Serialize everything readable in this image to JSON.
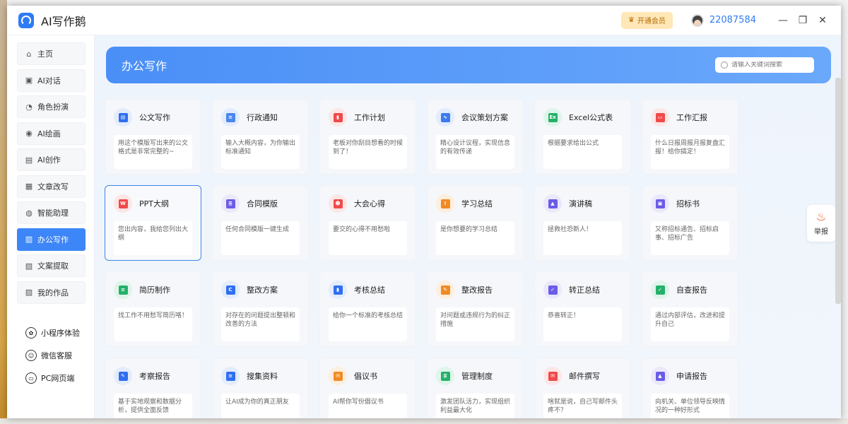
{
  "app": {
    "title": "AI写作鹅",
    "vip_label": "开通会员",
    "username": "22087584"
  },
  "window_controls": {
    "minimize": "—",
    "maximize": "❐",
    "close": "✕"
  },
  "sidebar": {
    "items": [
      {
        "label": "主页",
        "icon": "⌂"
      },
      {
        "label": "AI对话",
        "icon": "▣"
      },
      {
        "label": "角色扮演",
        "icon": "◔"
      },
      {
        "label": "AI绘画",
        "icon": "◉"
      },
      {
        "label": "AI创作",
        "icon": "▤"
      },
      {
        "label": "文章改写",
        "icon": "▦"
      },
      {
        "label": "智能助理",
        "icon": "◍"
      },
      {
        "label": "办公写作",
        "icon": "▥"
      },
      {
        "label": "文案提取",
        "icon": "▧"
      },
      {
        "label": "我的作品",
        "icon": "▨"
      }
    ],
    "active_index": 7,
    "extras": [
      {
        "label": "小程序体验",
        "icon": "✿"
      },
      {
        "label": "微信客服",
        "icon": "☺"
      },
      {
        "label": "PC网页端",
        "icon": "▭"
      }
    ]
  },
  "banner": {
    "title": "办公写作",
    "search_placeholder": "请输入关键词搜索"
  },
  "report": {
    "label": "举报",
    "icon": "♨"
  },
  "cards": [
    {
      "title": "公文写作",
      "desc": "用这个模版写出来的公文格式是非常完整的~",
      "icon": "file-icon",
      "color": "#2f6ff0",
      "bg": "#e3ecfd",
      "glyph": "▤"
    },
    {
      "title": "行政通知",
      "desc": "输入大概内容，为你输出标准通知",
      "icon": "notice-icon",
      "color": "#4a86f0",
      "bg": "#e3ecfd",
      "glyph": "≡"
    },
    {
      "title": "工作计划",
      "desc": "老板对你刮目想看的时候到了！",
      "icon": "flag-icon",
      "color": "#ef4a4a",
      "bg": "#fde6e6",
      "glyph": "▮"
    },
    {
      "title": "会议策划方案",
      "desc": "精心设计议程，实现信息的有效传递",
      "icon": "chart-icon",
      "color": "#3c7af0",
      "bg": "#e3ecfd",
      "glyph": "∿"
    },
    {
      "title": "Excel公式表",
      "desc": "根据要求给出公式",
      "icon": "excel-icon",
      "color": "#25b06a",
      "bg": "#dff5ea",
      "glyph": "Ex"
    },
    {
      "title": "工作汇报",
      "desc": "什么日报周报月报复盘汇报！给你搞定！",
      "icon": "briefcase-icon",
      "color": "#ef4a4a",
      "bg": "#fde6e6",
      "glyph": "▭"
    },
    {
      "title": "PPT大纲",
      "desc": "您出内容，我给您列出大纲",
      "icon": "ppt-icon",
      "color": "#ef4a4a",
      "bg": "#fde6e6",
      "glyph": "W"
    },
    {
      "title": "合同模版",
      "desc": "任何合同模版一键生成",
      "icon": "contract-icon",
      "color": "#6b5ce7",
      "bg": "#ebe8fc",
      "glyph": "≣"
    },
    {
      "title": "大会心得",
      "desc": "要交的心得不用愁啦",
      "icon": "people-icon",
      "color": "#ef4a4a",
      "bg": "#fde6e6",
      "glyph": "☻"
    },
    {
      "title": "学习总结",
      "desc": "是你想要的学习总结",
      "icon": "book-icon",
      "color": "#f08a25",
      "bg": "#fdeedd",
      "glyph": "!"
    },
    {
      "title": "演讲稿",
      "desc": "拯救社恐新人！",
      "icon": "podium-icon",
      "color": "#6b5ce7",
      "bg": "#ebe8fc",
      "glyph": "▲"
    },
    {
      "title": "招标书",
      "desc": "又称招标通告、招标启事、招标广告",
      "icon": "doc-icon",
      "color": "#6b5ce7",
      "bg": "#ebe8fc",
      "glyph": "▣"
    },
    {
      "title": "简历制作",
      "desc": "找工作不用愁写简历咯！",
      "icon": "resume-icon",
      "color": "#25b06a",
      "bg": "#dff5ea",
      "glyph": "≡"
    },
    {
      "title": "整改方案",
      "desc": "对存在的问题提出整顿和改善的方法",
      "icon": "clipboard-icon",
      "color": "#2f6ff0",
      "bg": "#e3ecfd",
      "glyph": "C"
    },
    {
      "title": "考核总结",
      "desc": "给你一个标准的考核总结",
      "icon": "bookmark-icon",
      "color": "#2f6ff0",
      "bg": "#e3ecfd",
      "glyph": "▮"
    },
    {
      "title": "整改报告",
      "desc": "对问题或违规行为的纠正措施",
      "icon": "tools-icon",
      "color": "#f08a25",
      "bg": "#fdeedd",
      "glyph": "✎"
    },
    {
      "title": "转正总结",
      "desc": "恭喜转正！",
      "icon": "user-check-icon",
      "color": "#6b5ce7",
      "bg": "#ebe8fc",
      "glyph": "✓"
    },
    {
      "title": "自查报告",
      "desc": "通过内部评估，改进和提升自己",
      "icon": "folder-check-icon",
      "color": "#25b06a",
      "bg": "#dff5ea",
      "glyph": "✓"
    },
    {
      "title": "考察报告",
      "desc": "基于实地观察和数据分析，提供全面反馈",
      "icon": "edit-icon",
      "color": "#2f6ff0",
      "bg": "#e3ecfd",
      "glyph": "✎"
    },
    {
      "title": "搜集资料",
      "desc": "让AI成为你的真正朋友",
      "icon": "collect-icon",
      "color": "#2f6ff0",
      "bg": "#e3ecfd",
      "glyph": "≡"
    },
    {
      "title": "倡议书",
      "desc": "AI帮你写份倡议书",
      "icon": "mail-icon",
      "color": "#f08a25",
      "bg": "#fdeedd",
      "glyph": "✉"
    },
    {
      "title": "管理制度",
      "desc": "激发团队活力，实现组织利益最大化",
      "icon": "rules-icon",
      "color": "#25b06a",
      "bg": "#dff5ea",
      "glyph": "≣"
    },
    {
      "title": "邮件撰写",
      "desc": "啥就是说，自己写邮件头疼不？",
      "icon": "email-icon",
      "color": "#ef4a4a",
      "bg": "#fde6e6",
      "glyph": "✉"
    },
    {
      "title": "申请报告",
      "desc": "向机关、单位领导反映情况的一种好形式",
      "icon": "stamp-icon",
      "color": "#6b5ce7",
      "bg": "#ebe8fc",
      "glyph": "▲"
    }
  ],
  "selected_card_index": 6
}
